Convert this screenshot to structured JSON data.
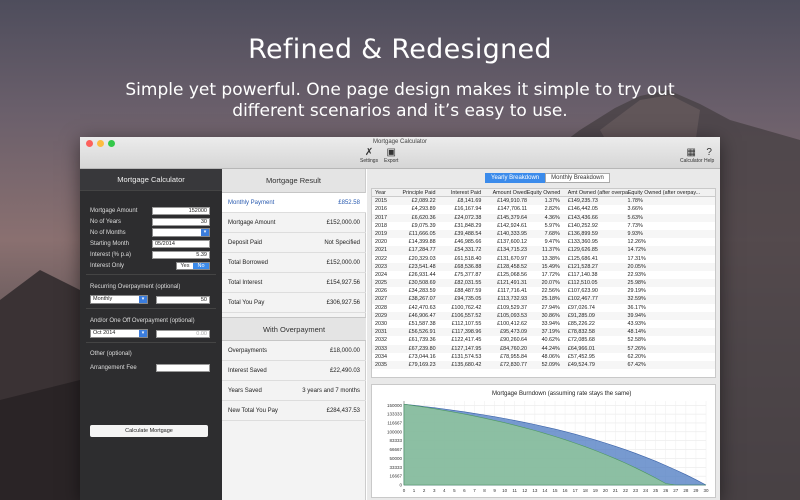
{
  "hero": {
    "title": "Refined & Redesigned",
    "subtitle": "Simple yet powerful. One page design makes it simple to try out different scenarios and it’s easy to use."
  },
  "window": {
    "title": "Mortgage Calculator",
    "toolbar": {
      "settings": "Settings",
      "export": "Export",
      "calculator": "Calculator",
      "help": "Help"
    }
  },
  "colors": {
    "accent": "#3b8beb",
    "panel_dark": "#2d2d2f",
    "close": "#fc605c",
    "minimize": "#fdbc40",
    "zoom": "#34c84a",
    "chart_fill": "#8fc59b",
    "chart_line": "#4a78c0"
  },
  "left_panel": {
    "title": "Mortgage Calculator",
    "mortgage_amount": {
      "label": "Mortgage Amount",
      "value": "152000"
    },
    "years": {
      "label": "No of Years",
      "value": "30"
    },
    "months": {
      "label": "No of Months",
      "value": ""
    },
    "start_month": {
      "label": "Starting Month",
      "value": "05/2014"
    },
    "interest": {
      "label": "Interest (% p.a)",
      "value": "5.39"
    },
    "interest_only": {
      "label": "Interest Only",
      "yes": "Yes",
      "no": "No"
    },
    "recurring": {
      "label": "Recurring Overpayment (optional)",
      "frequency": "Monthly",
      "amount": "50"
    },
    "one_off": {
      "label": "And/or One Off Overpayment (optional)",
      "date": "Oct 2014",
      "amount": "0.00"
    },
    "other": {
      "label": "Other (optional)",
      "arrangement_label": "Arrangement Fee",
      "arrangement_value": ""
    },
    "calculate_label": "Calculate Mortgage"
  },
  "result": {
    "title": "Mortgage Result",
    "rows": [
      {
        "label": "Monthly Payment",
        "value": "£852.58"
      },
      {
        "label": "Mortgage Amount",
        "value": "£152,000.00"
      },
      {
        "label": "Deposit Paid",
        "value": "Not Specified"
      },
      {
        "label": "Total Borrowed",
        "value": "£152,000.00"
      },
      {
        "label": "Total Interest",
        "value": "£154,927.56"
      },
      {
        "label": "Total You Pay",
        "value": "£306,927.56"
      }
    ],
    "overpayment_title": "With Overpayment",
    "overpayment_rows": [
      {
        "label": "Overpayments",
        "value": "£18,000.00"
      },
      {
        "label": "Interest Saved",
        "value": "£22,490.03"
      },
      {
        "label": "Years Saved",
        "value": "3 years and 7 months"
      },
      {
        "label": "New Total You Pay",
        "value": "£284,437.53"
      }
    ]
  },
  "breakdown": {
    "tabs": [
      "Yearly Breakdown",
      "Monthly Breakdown"
    ],
    "columns": [
      "Year",
      "Principle Paid",
      "Interest Paid",
      "Amount Owed",
      "Equity Owned",
      "Amt Owned (after overpa...",
      "Equity Owned (after overpay..."
    ],
    "rows": [
      [
        "2015",
        "£2,089.22",
        "£8,141.69",
        "£149,910.78",
        "1.37%",
        "£149,235.73",
        "1.78%"
      ],
      [
        "2016",
        "£4,293.89",
        "£16,167.94",
        "£147,706.11",
        "2.82%",
        "£146,442.05",
        "3.66%"
      ],
      [
        "2017",
        "£6,620.36",
        "£24,072.38",
        "£145,379.64",
        "4.36%",
        "£143,436.66",
        "5.63%"
      ],
      [
        "2018",
        "£9,075.39",
        "£31,848.29",
        "£142,924.61",
        "5.97%",
        "£140,252.92",
        "7.73%"
      ],
      [
        "2019",
        "£11,666.05",
        "£39,488.54",
        "£140,333.95",
        "7.68%",
        "£136,899.59",
        "9.93%"
      ],
      [
        "2020",
        "£14,399.88",
        "£46,985.66",
        "£137,600.12",
        "9.47%",
        "£133,360.95",
        "12.26%"
      ],
      [
        "2021",
        "£17,284.77",
        "£54,331.72",
        "£134,715.23",
        "11.37%",
        "£129,626.85",
        "14.72%"
      ],
      [
        "2022",
        "£20,329.03",
        "£61,518.40",
        "£131,670.97",
        "13.38%",
        "£125,686.41",
        "17.31%"
      ],
      [
        "2023",
        "£23,541.48",
        "£68,536.88",
        "£128,458.52",
        "15.49%",
        "£121,528.27",
        "20.05%"
      ],
      [
        "2024",
        "£26,931.44",
        "£75,377.87",
        "£125,068.56",
        "17.72%",
        "£117,140.38",
        "22.93%"
      ],
      [
        "2025",
        "£30,508.69",
        "£82,031.55",
        "£121,491.31",
        "20.07%",
        "£112,510.05",
        "25.98%"
      ],
      [
        "2026",
        "£34,283.59",
        "£88,487.59",
        "£117,716.41",
        "22.56%",
        "£107,623.90",
        "29.19%"
      ],
      [
        "2027",
        "£38,267.07",
        "£94,735.05",
        "£113,732.93",
        "25.18%",
        "£102,467.77",
        "32.59%"
      ],
      [
        "2028",
        "£42,470.63",
        "£100,762.42",
        "£109,529.37",
        "27.94%",
        "£97,026.74",
        "36.17%"
      ],
      [
        "2029",
        "£46,906.47",
        "£106,557.52",
        "£105,093.53",
        "30.86%",
        "£91,285.09",
        "39.94%"
      ],
      [
        "2030",
        "£51,587.38",
        "£112,107.55",
        "£100,412.62",
        "33.94%",
        "£85,226.22",
        "43.93%"
      ],
      [
        "2031",
        "£56,526.91",
        "£117,398.96",
        "£95,473.09",
        "37.19%",
        "£78,832.58",
        "48.14%"
      ],
      [
        "2032",
        "£61,739.36",
        "£122,417.45",
        "£90,260.64",
        "40.62%",
        "£72,085.68",
        "52.58%"
      ],
      [
        "2033",
        "£67,239.80",
        "£127,147.95",
        "£84,760.20",
        "44.24%",
        "£64,966.01",
        "57.26%"
      ],
      [
        "2034",
        "£73,044.16",
        "£131,574.53",
        "£78,955.84",
        "48.06%",
        "£57,452.95",
        "62.20%"
      ],
      [
        "2035",
        "£79,169.23",
        "£135,680.42",
        "£72,830.77",
        "52.09%",
        "£49,524.79",
        "67.42%"
      ]
    ]
  },
  "chart_data": {
    "type": "area",
    "title": "Mortgage Burndown (assuming rate stays the same)",
    "x": [
      0,
      1,
      2,
      3,
      4,
      5,
      6,
      7,
      8,
      9,
      10,
      11,
      12,
      13,
      14,
      15,
      16,
      17,
      18,
      19,
      20,
      21,
      22,
      23,
      24,
      25,
      26,
      27,
      28,
      29,
      30
    ],
    "series": [
      {
        "values": [
          152000,
          149911,
          147706,
          145380,
          142925,
          140334,
          137600,
          134715,
          131671,
          128459,
          125069,
          121491,
          117716,
          113733,
          109529,
          105094,
          100413,
          95473,
          90261,
          84760,
          78956,
          72831,
          66367,
          59547,
          52351,
          44758,
          36746,
          28292,
          19372,
          9960,
          0
        ]
      },
      {
        "values": [
          152000,
          149236,
          146442,
          143437,
          140253,
          136900,
          133361,
          129627,
          125686,
          121528,
          117140,
          112510,
          107624,
          102468,
          97027,
          91285,
          85226,
          78833,
          72086,
          64966,
          57453,
          49525,
          41159,
          32331,
          23015,
          13185,
          2812,
          0,
          0,
          0,
          0
        ]
      }
    ],
    "yticks": [
      "150000",
      "133333",
      "116667",
      "100000",
      "83333",
      "66667",
      "50000",
      "33333",
      "16667",
      "0"
    ],
    "ylim": [
      0,
      158000
    ],
    "xlim": [
      0,
      30
    ]
  }
}
